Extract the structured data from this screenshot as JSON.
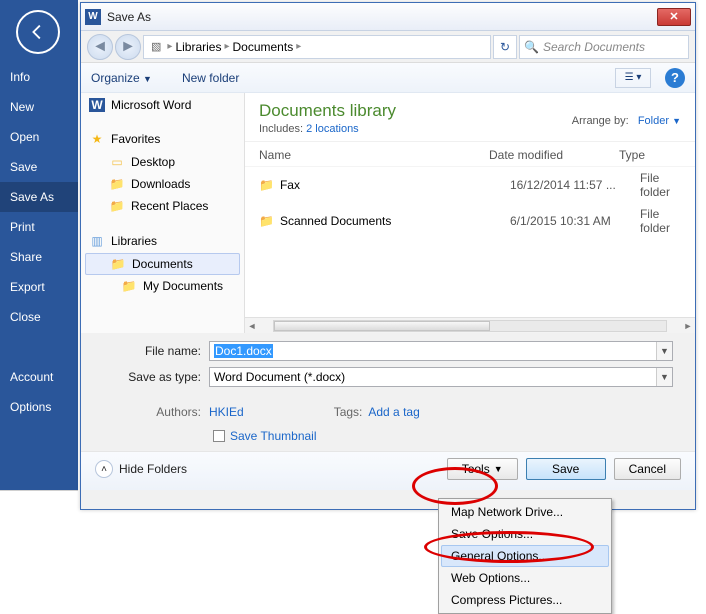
{
  "sidebar": {
    "items": [
      "Info",
      "New",
      "Open",
      "Save",
      "Save As",
      "Print",
      "Share",
      "Export",
      "Close"
    ],
    "bottom": [
      "Account",
      "Options"
    ],
    "active_index": 4
  },
  "dialog": {
    "title": "Save As",
    "breadcrumb": {
      "root": "Libraries",
      "folder": "Documents"
    },
    "search_placeholder": "Search Documents",
    "toolbar": {
      "organize": "Organize",
      "newfolder": "New folder"
    },
    "tree": {
      "word": "Microsoft Word",
      "favorites": "Favorites",
      "fav_children": [
        "Desktop",
        "Downloads",
        "Recent Places"
      ],
      "libraries": "Libraries",
      "lib_children": [
        "Documents",
        "My Documents"
      ]
    },
    "content": {
      "heading": "Documents library",
      "includes_label": "Includes:",
      "includes_link": "2 locations",
      "arrange_label": "Arrange by:",
      "arrange_value": "Folder",
      "cols": {
        "name": "Name",
        "date": "Date modified",
        "type": "Type"
      },
      "rows": [
        {
          "name": "Fax",
          "date": "16/12/2014 11:57 ...",
          "type": "File folder"
        },
        {
          "name": "Scanned Documents",
          "date": "6/1/2015 10:31 AM",
          "type": "File folder"
        }
      ]
    },
    "form": {
      "filename_label": "File name:",
      "filename_value": "Doc1.docx",
      "savetype_label": "Save as type:",
      "savetype_value": "Word Document (*.docx)",
      "authors_label": "Authors:",
      "authors_value": "HKIEd",
      "tags_label": "Tags:",
      "tags_value": "Add a tag",
      "thumb_label": "Save Thumbnail"
    },
    "footer": {
      "hide": "Hide Folders",
      "tools": "Tools",
      "save": "Save",
      "cancel": "Cancel"
    },
    "tools_menu": [
      "Map Network Drive...",
      "Save Options...",
      "General Options...",
      "Web Options...",
      "Compress Pictures..."
    ]
  }
}
